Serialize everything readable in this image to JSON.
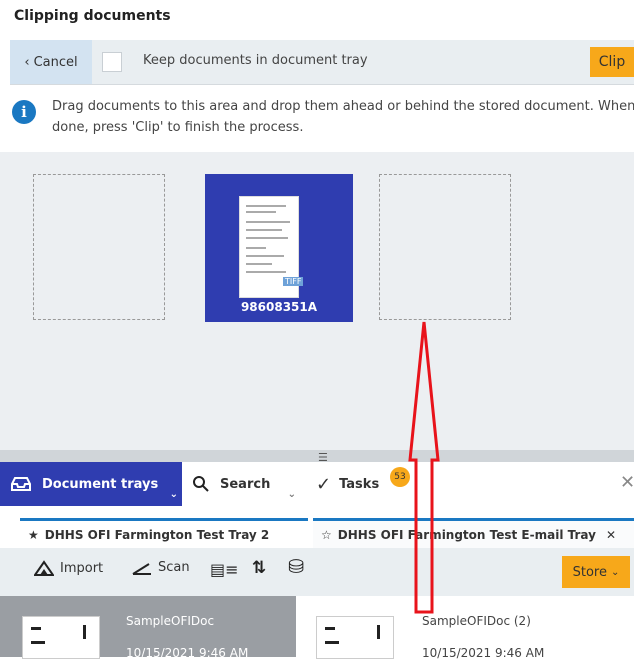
{
  "header": {
    "title": "Clipping documents"
  },
  "toolbar": {
    "cancel_label": "Cancel",
    "keep_label": "Keep documents in document tray",
    "clip_label": "Clip"
  },
  "info": {
    "text": "Drag documents to this area and drop them ahead or behind the stored document. When done, press 'Clip' to finish the process."
  },
  "drop_area": {
    "document": {
      "name": "98608351A",
      "format_badge": "TIFF"
    }
  },
  "nav": {
    "tabs": [
      {
        "label": "Document trays",
        "icon": "tray-icon"
      },
      {
        "label": "Search",
        "icon": "search-icon"
      },
      {
        "label": "Tasks",
        "icon": "check-icon",
        "badge": "53"
      }
    ]
  },
  "tray_tabs": [
    {
      "label": "DHHS OFI Farmington Test Tray 2",
      "icon": "star-filled-icon"
    },
    {
      "label": "DHHS OFI Farmington Test E-mail Tray",
      "icon": "star-outline-icon"
    }
  ],
  "actions": {
    "import_label": "Import",
    "scan_label": "Scan",
    "store_label": "Store"
  },
  "documents": [
    {
      "title": "SampleOFIDoc",
      "date": "10/15/2021 9:46 AM"
    },
    {
      "title": "SampleOFIDoc (2)",
      "date": "10/15/2021 9:46 AM"
    }
  ],
  "colors": {
    "accent_blue": "#2f3db0",
    "accent_orange": "#f7a81a",
    "annotation_red": "#e8131b"
  }
}
